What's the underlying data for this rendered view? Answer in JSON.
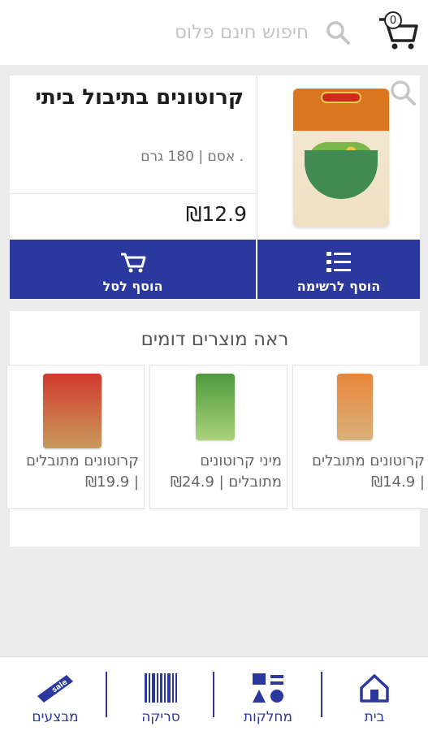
{
  "header": {
    "cart_count": "0",
    "search_placeholder": "חיפוש חינם פלוס"
  },
  "product": {
    "title": "קרוטונים בתיבול ביתי",
    "meta": ". אסם | 180 גרם",
    "price": "₪12.9",
    "add_to_cart_label": "הוסף לסל",
    "add_to_list_label": "הוסף לרשימה"
  },
  "similar": {
    "title": "ראה מוצרים דומים",
    "items": [
      {
        "name_line1": "קרוטונים מתובלים",
        "name_line2": "| ₪14.9",
        "pack_color": "#e07a2a"
      },
      {
        "name_line1": "מיני קרוטונים",
        "name_line2": "מתובלים | ₪24.9",
        "pack_color": "#5aa844"
      },
      {
        "name_line1": "קרוטונים מתובלים",
        "name_line2": "| ₪19.9",
        "pack_color": "#c9372c"
      }
    ]
  },
  "bottom_nav": {
    "home_label": "בית",
    "departments_label": "מחלקות",
    "scan_label": "סריקה",
    "deals_label": "מבצעים",
    "sale_tag": "sale"
  },
  "colors": {
    "brand_blue": "#2b389d",
    "background": "#ececec"
  }
}
